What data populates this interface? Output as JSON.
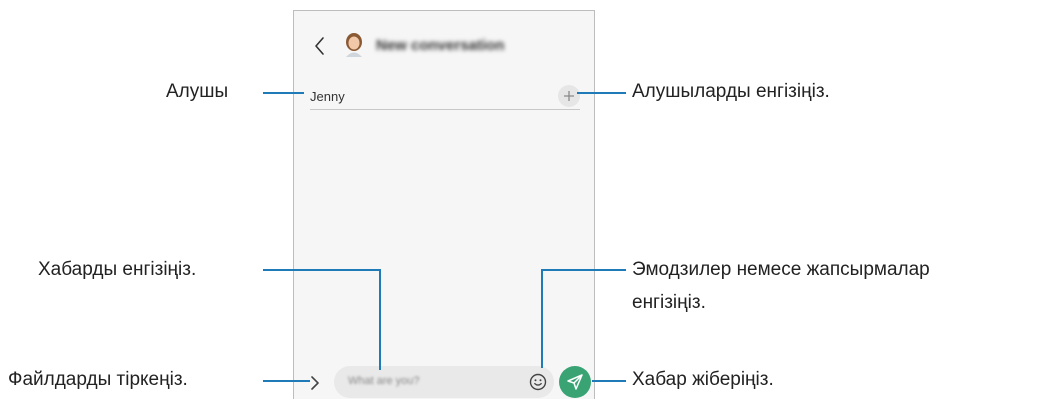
{
  "header": {
    "title": "New conversation"
  },
  "recipient": {
    "value": "Jenny"
  },
  "composer": {
    "placeholder": "What are you?"
  },
  "callouts": {
    "recipient": "Алушы",
    "add_recipients": "Алушыларды енгізіңіз.",
    "enter_message": "Хабарды енгізіңіз.",
    "emoji_line1": "Эмодзилер немесе жапсырмалар",
    "emoji_line2": "енгізіңіз.",
    "attach_files": "Файлдарды тіркеңіз.",
    "send_message": "Хабар жіберіңіз."
  },
  "colors": {
    "leader_line": "#1f7bb8",
    "send_button": "#3aa374",
    "phone_background": "#f6f6f6"
  },
  "icons": [
    "chevron-left-icon",
    "avatar-icon",
    "plus-icon",
    "chevron-right-icon",
    "emoji-icon",
    "send-icon"
  ]
}
